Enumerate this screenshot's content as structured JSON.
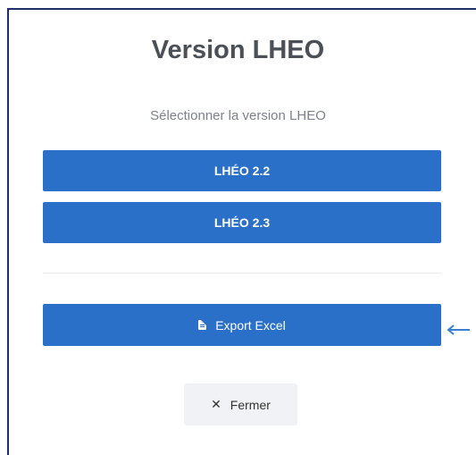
{
  "modal": {
    "title": "Version LHEO",
    "subtitle": "Sélectionner la version LHEO"
  },
  "buttons": {
    "lheo_22": "LHÉO 2.2",
    "lheo_23": "LHÉO 2.3",
    "export_excel": "Export Excel",
    "close": "Fermer"
  },
  "icons": {
    "export": "file-excel-icon",
    "close": "close-icon",
    "annotation_arrow": "left-arrow-icon"
  },
  "colors": {
    "primary": "#2a70c9",
    "frame_border": "#1f2d6b",
    "annotation_arrow": "#3b7fd0",
    "close_button_bg": "#f0f2f5"
  }
}
